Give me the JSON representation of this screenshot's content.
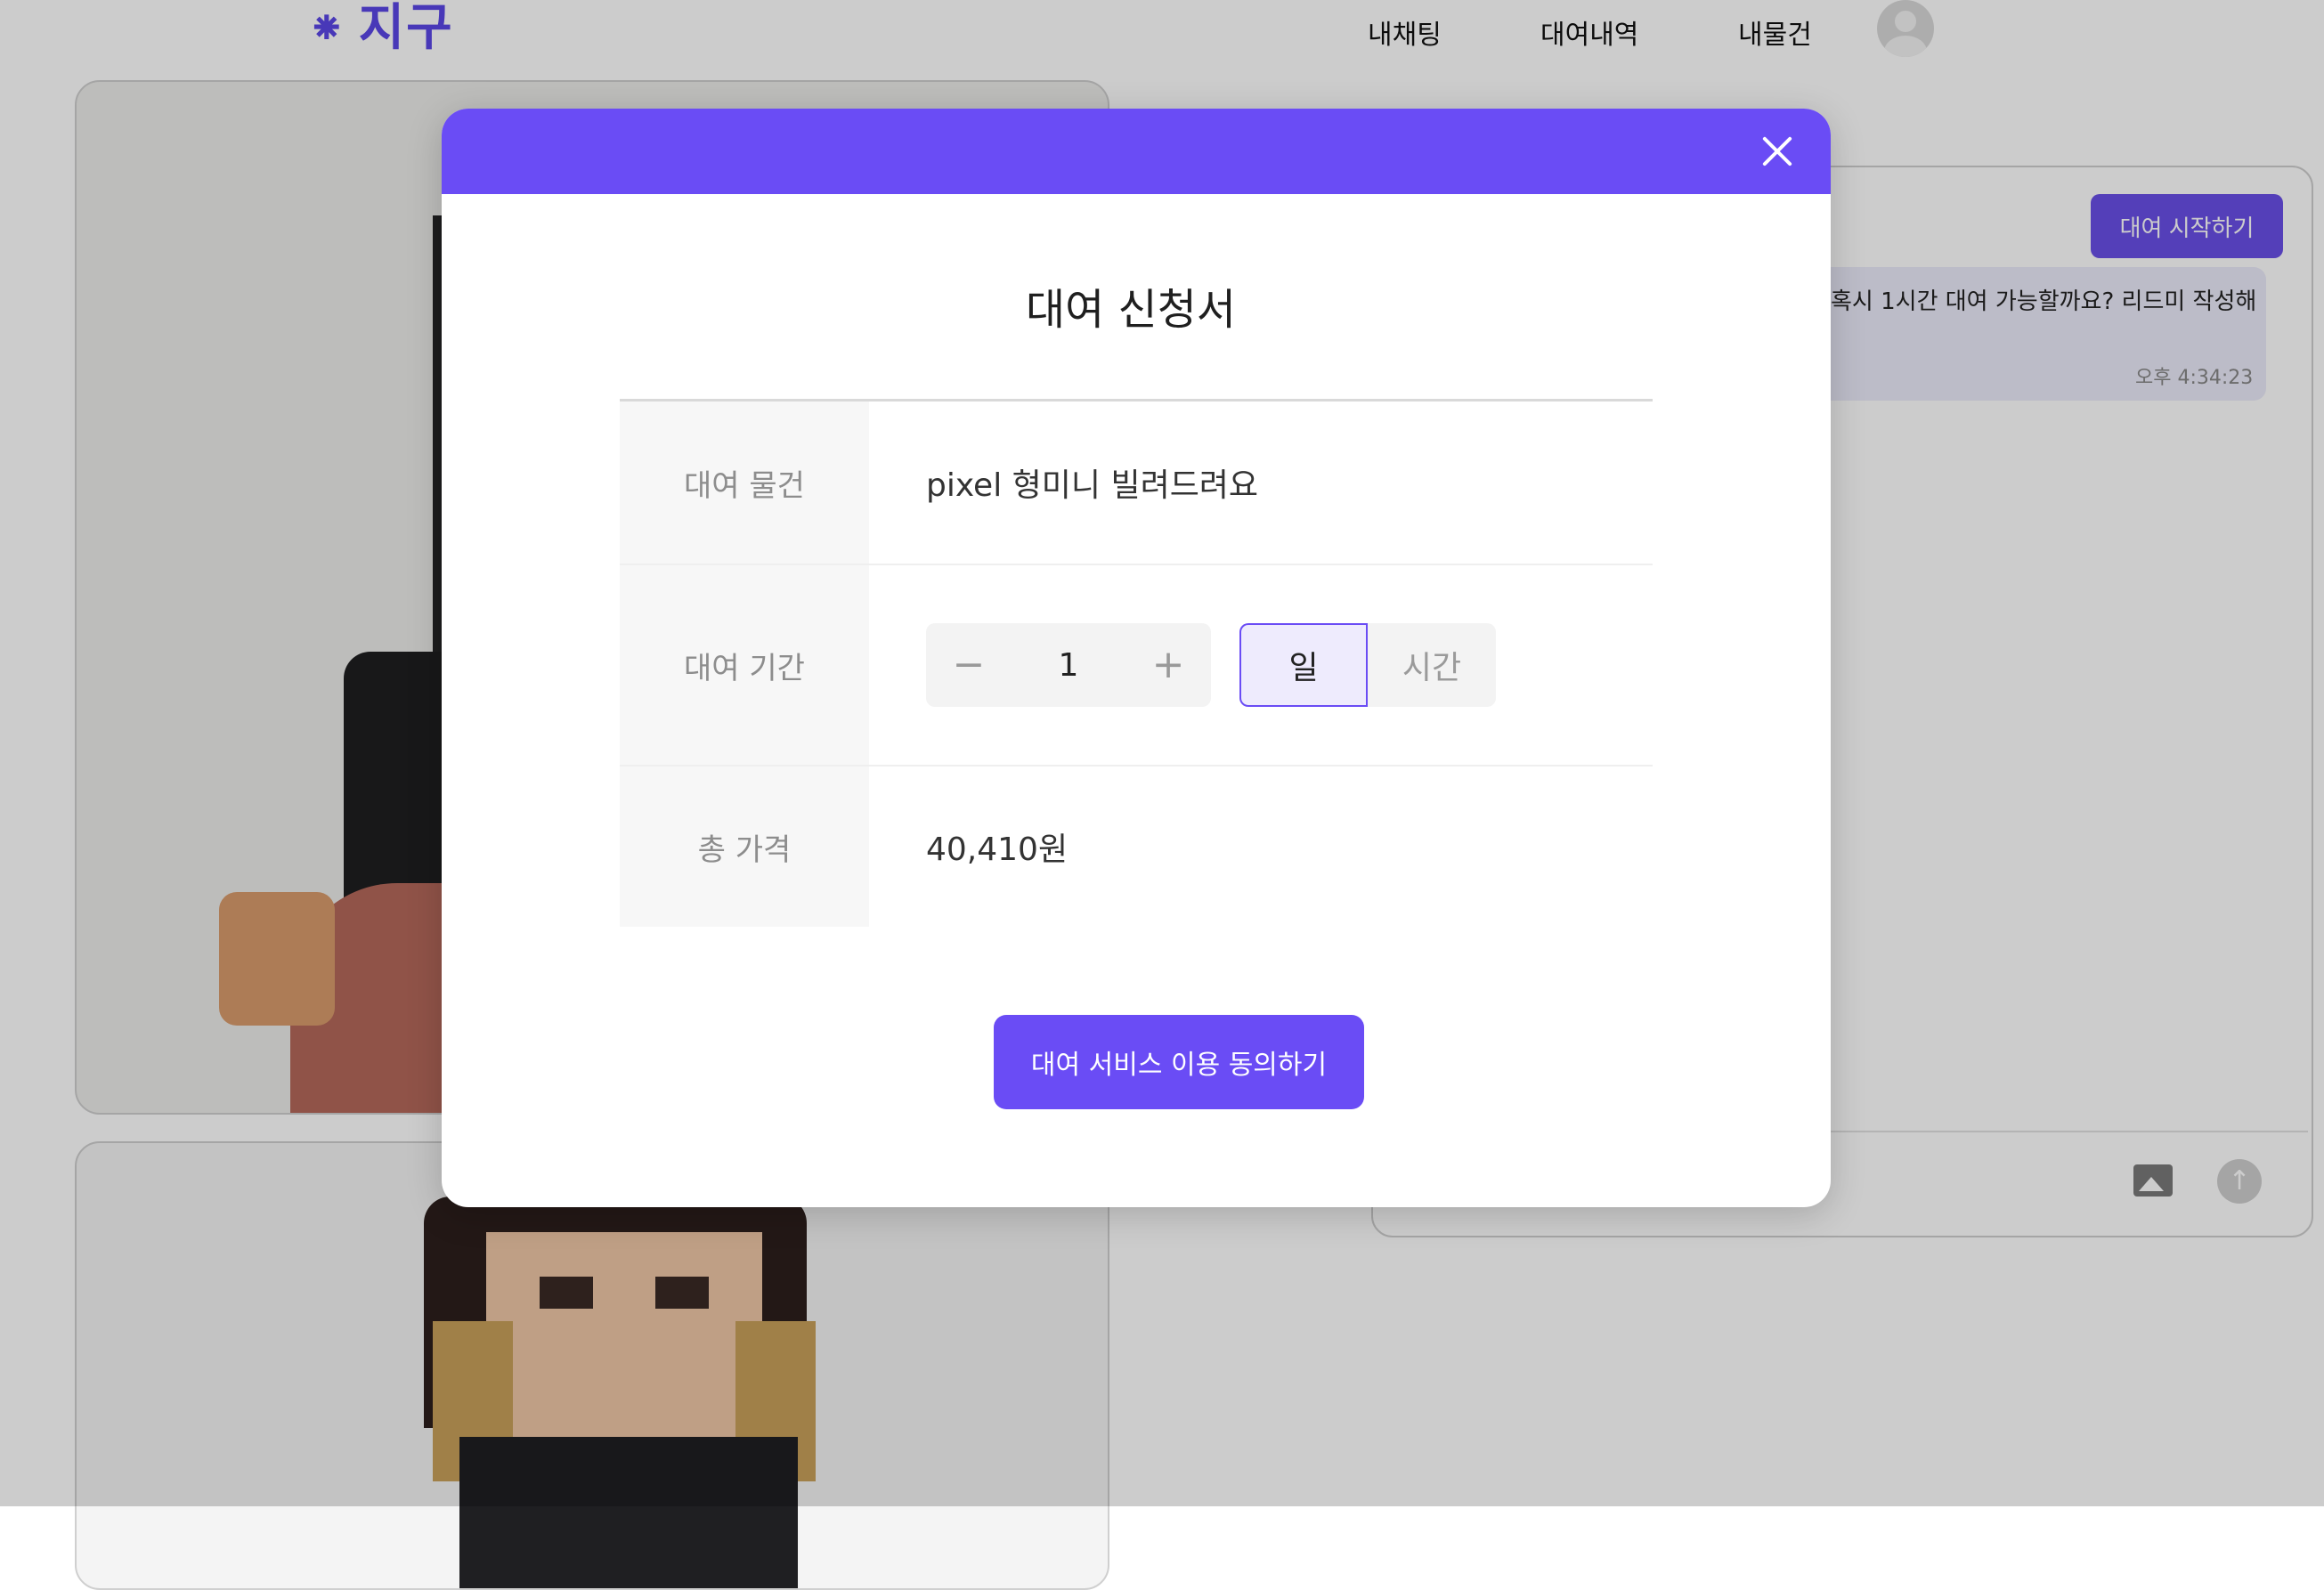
{
  "brand": {
    "logo_text": "지구",
    "logo_mark": "⁕"
  },
  "nav": {
    "items": [
      {
        "label": "내채팅"
      },
      {
        "label": "대여내역"
      },
      {
        "label": "내물건"
      }
    ]
  },
  "chat": {
    "start_button": "대여 시작하기",
    "message": "혹시 1시간 대여 가능할까요? 리드미 작성해",
    "time": "오후 4:34:23",
    "send_icon": "arrow-up-icon",
    "image_icon": "image-icon"
  },
  "modal": {
    "title": "대여 신청서",
    "rows": [
      {
        "label": "대여 물건",
        "value": "pixel 형미니 빌려드려요"
      },
      {
        "label": "대여 기간"
      },
      {
        "label": "총 가격",
        "value": "40,410원"
      }
    ],
    "stepper": {
      "minus": "−",
      "value": "1",
      "plus": "+"
    },
    "units": {
      "day": "일",
      "hour": "시간",
      "selected": "일"
    },
    "submit": "대여 서비스 이용 동의하기"
  },
  "colors": {
    "accent": "#6a4cf5",
    "selected_bg": "#eeebfd",
    "overlay": "rgba(0,0,0,0.2)"
  }
}
